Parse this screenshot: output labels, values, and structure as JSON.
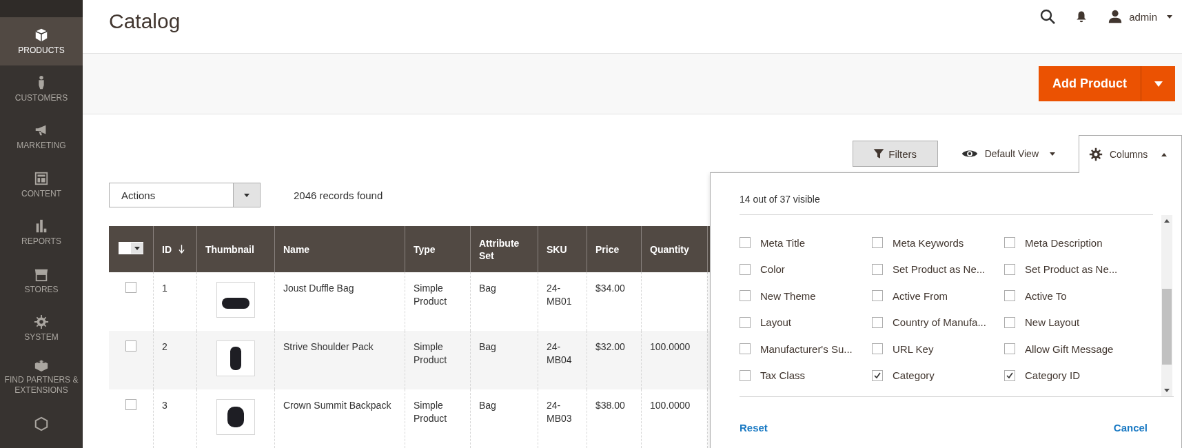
{
  "sidebar": {
    "items": [
      {
        "label": "PRODUCTS",
        "selected": true
      },
      {
        "label": "CUSTOMERS",
        "selected": false
      },
      {
        "label": "MARKETING",
        "selected": false
      },
      {
        "label": "CONTENT",
        "selected": false
      },
      {
        "label": "REPORTS",
        "selected": false
      },
      {
        "label": "STORES",
        "selected": false
      },
      {
        "label": "SYSTEM",
        "selected": false
      },
      {
        "label": "FIND PARTNERS & EXTENSIONS",
        "selected": false
      },
      {
        "selected": false
      }
    ]
  },
  "header": {
    "title": "Catalog",
    "user": "admin",
    "add_button": "Add Product"
  },
  "toolbar": {
    "actions": "Actions",
    "records": "2046 records found",
    "filters": "Filters",
    "view": "Default View",
    "columns": {
      "label": "Columns",
      "expanded": true
    }
  },
  "table": {
    "mass_select": {
      "checked": false
    },
    "columns": [
      {
        "label": "ID",
        "sorted": true
      },
      {
        "label": "Thumbnail",
        "sorted": false
      },
      {
        "label": "Name",
        "sorted": false
      },
      {
        "label": "Type",
        "sorted": false
      },
      {
        "label": "Attribute Set",
        "sorted": false
      },
      {
        "label": "SKU",
        "sorted": false
      },
      {
        "label": "Price",
        "sorted": false
      },
      {
        "label": "Quantity",
        "sorted": false
      }
    ],
    "rows": [
      {
        "checked": false,
        "id": "1",
        "name": "Joust Duffle Bag",
        "type": "Simple Product",
        "attribute_set": "Bag",
        "sku": "24-MB01",
        "price": "$34.00",
        "quantity": ""
      },
      {
        "checked": false,
        "id": "2",
        "name": "Strive Shoulder Pack",
        "type": "Simple Product",
        "attribute_set": "Bag",
        "sku": "24-MB04",
        "price": "$32.00",
        "quantity": "100.0000"
      },
      {
        "checked": false,
        "id": "3",
        "name": "Crown Summit Backpack",
        "type": "Simple Product",
        "attribute_set": "Bag",
        "sku": "24-MB03",
        "price": "$38.00",
        "quantity": "100.0000"
      }
    ]
  },
  "columns_panel": {
    "summary": "14 out of 37 visible",
    "options": [
      {
        "label": "Meta Title",
        "checked": false
      },
      {
        "label": "Meta Keywords",
        "checked": false
      },
      {
        "label": "Meta Description",
        "checked": false
      },
      {
        "label": "Color",
        "checked": false
      },
      {
        "label": "Set Product as Ne...",
        "checked": false
      },
      {
        "label": "Set Product as Ne...",
        "checked": false
      },
      {
        "label": "New Theme",
        "checked": false
      },
      {
        "label": "Active From",
        "checked": false
      },
      {
        "label": "Active To",
        "checked": false
      },
      {
        "label": "Layout",
        "checked": false
      },
      {
        "label": "Country of Manufa...",
        "checked": false
      },
      {
        "label": "New Layout",
        "checked": false
      },
      {
        "label": "Manufacturer's Su...",
        "checked": false
      },
      {
        "label": "URL Key",
        "checked": false
      },
      {
        "label": "Allow Gift Message",
        "checked": false
      },
      {
        "label": "Tax Class",
        "checked": false
      },
      {
        "label": "Category",
        "checked": true
      },
      {
        "label": "Category ID",
        "checked": true
      }
    ],
    "reset": "Reset",
    "cancel": "Cancel"
  }
}
